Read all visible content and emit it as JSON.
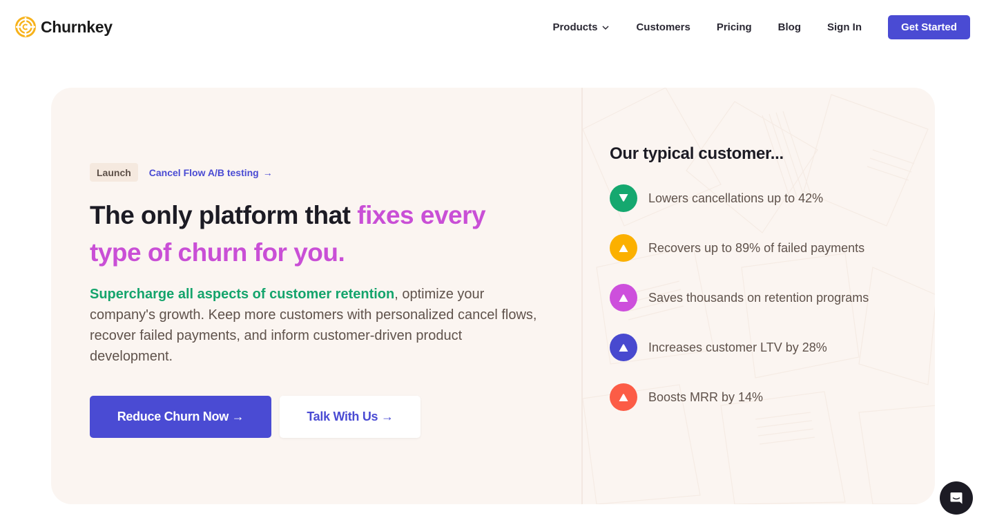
{
  "brand": {
    "name": "Churnkey",
    "logo_icon": "churnkey-logo-icon",
    "logo_color": "#f7b21b"
  },
  "nav": {
    "items": [
      {
        "label": "Products",
        "has_dropdown": true
      },
      {
        "label": "Customers"
      },
      {
        "label": "Pricing"
      },
      {
        "label": "Blog"
      },
      {
        "label": "Sign In"
      }
    ],
    "cta_label": "Get Started"
  },
  "hero": {
    "badge": "Launch",
    "badge_link": "Cancel Flow A/B testing",
    "badge_link_arrow": "→",
    "headline_plain": "The only platform that ",
    "headline_accent": "fixes every type of churn for you.",
    "description_highlight": "Supercharge all aspects of customer retention",
    "description_rest": ", optimize your company's growth. Keep more customers with personalized cancel flows, recover failed payments, and inform customer-driven product development.",
    "primary_button": "Reduce Churn Now →",
    "secondary_button": "Talk With Us →"
  },
  "stats": {
    "title": "Our typical customer...",
    "items": [
      {
        "text": "Lowers cancellations up to 42%",
        "icon": "triangle-down-icon",
        "color": "#15a86f"
      },
      {
        "text": "Recovers up to 89% of failed payments",
        "icon": "triangle-up-icon",
        "color": "#fbb000"
      },
      {
        "text": "Saves thousands on retention programs",
        "icon": "triangle-up-icon",
        "color": "#cd4fdc"
      },
      {
        "text": "Increases customer LTV by 28%",
        "icon": "triangle-up-icon",
        "color": "#4849cf"
      },
      {
        "text": "Boosts MRR by 14%",
        "icon": "triangle-up-icon",
        "color": "#fc5c46"
      }
    ]
  },
  "colors": {
    "primary": "#4a4bd3",
    "accent_pink": "#c94fd6",
    "accent_green": "#14a46c",
    "card_bg": "#fbf5f1"
  },
  "chat_widget": {
    "icon": "chat-icon"
  }
}
